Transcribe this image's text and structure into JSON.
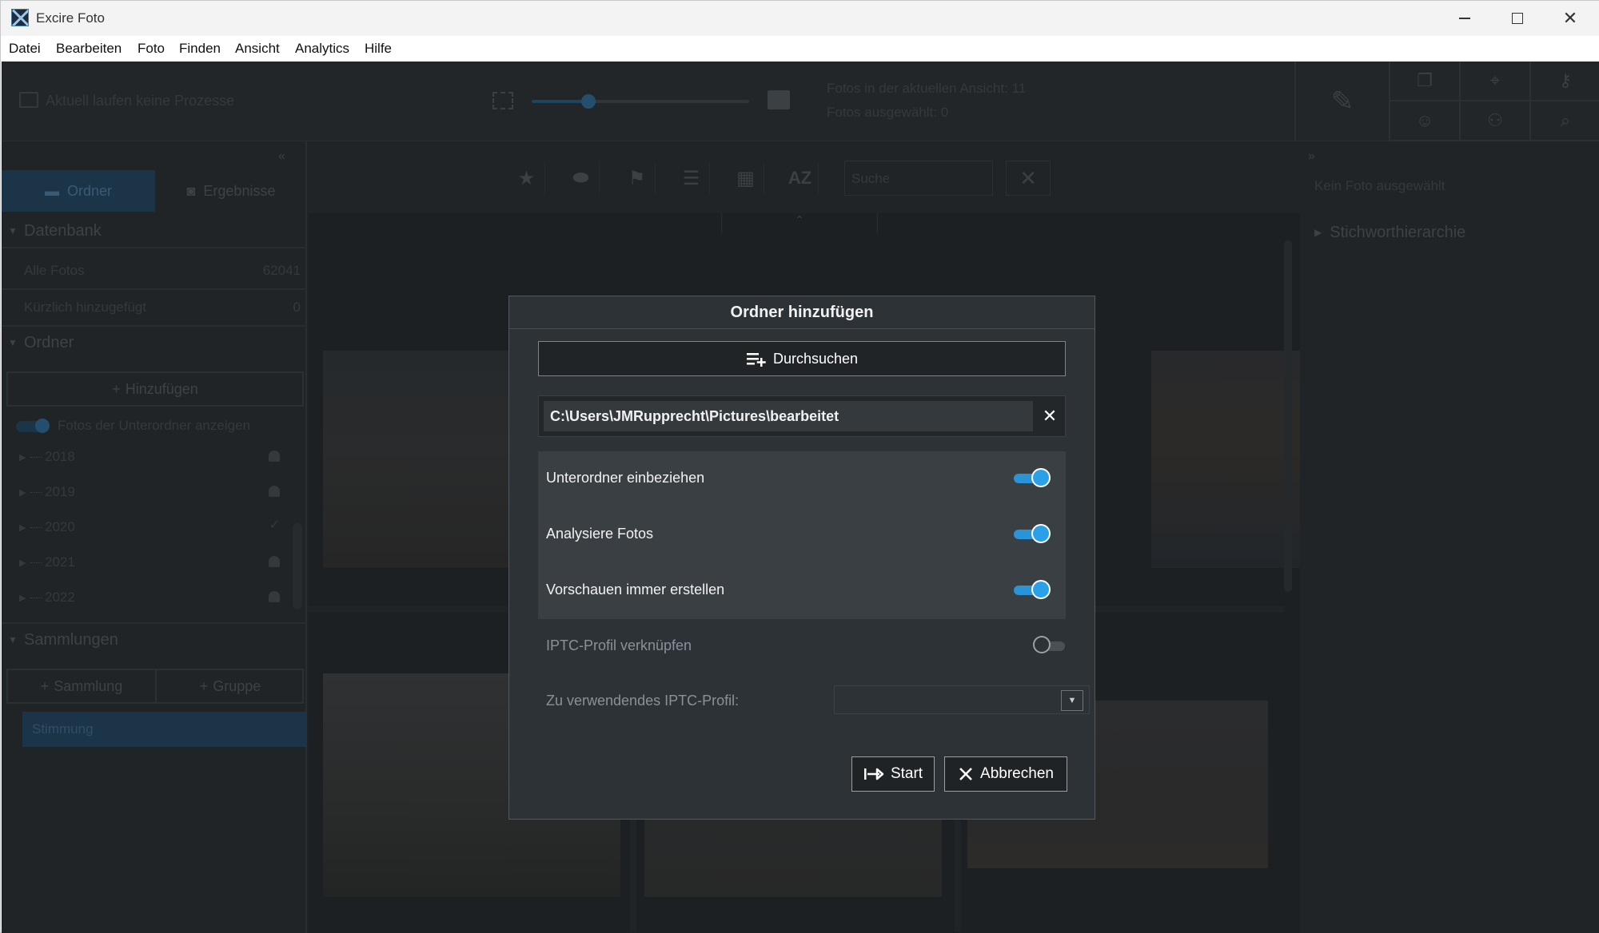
{
  "window": {
    "title": "Excire Foto"
  },
  "menu": [
    "Datei",
    "Bearbeiten",
    "Foto",
    "Finden",
    "Ansicht",
    "Analytics",
    "Hilfe"
  ],
  "toolbar": {
    "process_status": "Aktuell laufen keine Prozesse",
    "thumb_size_level": 0.26,
    "photos_in_view": "Fotos in der aktuellen Ansicht: 11",
    "photos_selected": "Fotos ausgewählt: 0",
    "icons": [
      "edit-metadata-icon",
      "duplicates-icon",
      "location-icon",
      "keyword-icon",
      "face-icon",
      "people-icon",
      "search-icon"
    ]
  },
  "left": {
    "tab_folders": "Ordner",
    "tab_results": "Ergebnisse",
    "section_database": "Datenbank",
    "all_photos_label": "Alle Fotos",
    "all_photos_count": "62041",
    "recent_label": "Kürzlich hinzugefügt",
    "recent_count": "0",
    "section_folders": "Ordner",
    "add_button": "Hinzufügen",
    "show_subfolder_photos": "Fotos der Unterordner anzeigen",
    "folders": [
      {
        "name": "2018",
        "status": "bell"
      },
      {
        "name": "2019",
        "status": "bell"
      },
      {
        "name": "2020",
        "status": "check"
      },
      {
        "name": "2021",
        "status": "bell"
      },
      {
        "name": "2022",
        "status": "bell"
      }
    ],
    "section_collections": "Sammlungen",
    "collection_button": "Sammlung",
    "group_button": "Gruppe",
    "collections": [
      "Stimmung"
    ]
  },
  "center": {
    "search_placeholder": "Suche",
    "filter_icons": [
      "star-icon",
      "label-icon",
      "flag-icon",
      "list-icon",
      "calendar-icon",
      "sort-az-icon"
    ]
  },
  "right": {
    "no_photo": "Kein Foto ausgewählt",
    "keyword_hierarchy": "Stichworthierarchie"
  },
  "dialog": {
    "title": "Ordner hinzufügen",
    "browse_button": "Durchsuchen",
    "path_value": "C:\\Users\\JMRupprecht\\Pictures\\bearbeitet",
    "options": [
      {
        "label": "Unterordner einbeziehen",
        "on": true
      },
      {
        "label": "Analysiere Fotos",
        "on": true
      },
      {
        "label": "Vorschauen immer erstellen",
        "on": true
      },
      {
        "label": "IPTC-Profil verknüpfen",
        "on": false
      }
    ],
    "iptc_profile_label": "Zu verwendendes IPTC-Profil:",
    "iptc_profile_value": "",
    "start_button": "Start",
    "cancel_button": "Abbrechen"
  }
}
